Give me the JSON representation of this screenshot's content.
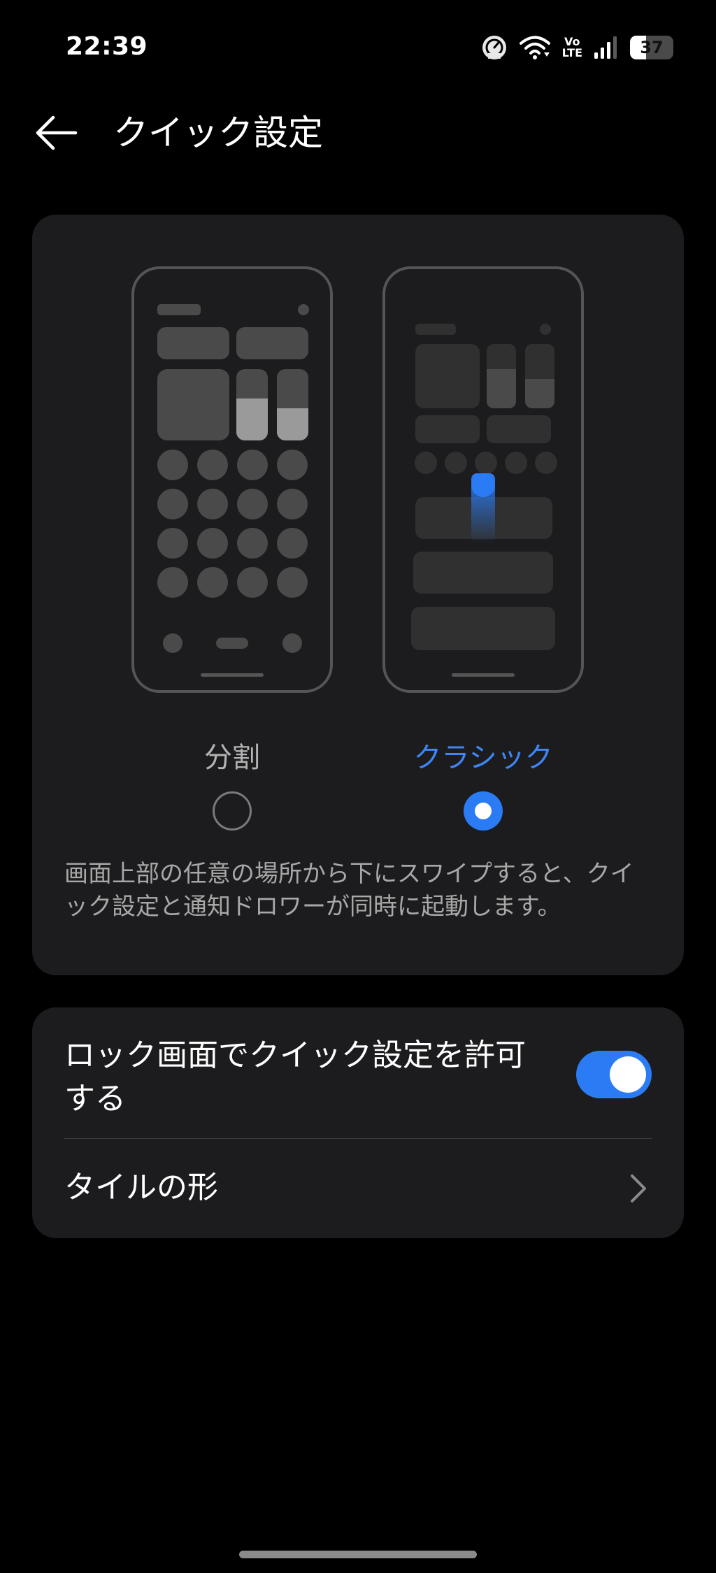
{
  "status_bar": {
    "time": "22:39",
    "volte_top": "Vo",
    "volte_bottom": "LTE",
    "battery_percent": "37",
    "icons": [
      "speedometer-icon",
      "wifi-icon",
      "volte-icon",
      "signal-icon",
      "battery-icon"
    ]
  },
  "header": {
    "back_icon": "arrow-left-icon",
    "title": "クイック設定"
  },
  "style_selector": {
    "options": [
      {
        "label": "分割",
        "selected": false
      },
      {
        "label": "クラシック",
        "selected": true
      }
    ],
    "description": "画面上部の任意の場所から下にスワイプすると、クイック設定と通知ドロワーが同時に起動します。"
  },
  "settings": {
    "lock_screen": {
      "label": "ロック画面でクイック設定を許可する",
      "enabled": true
    },
    "tile_shape": {
      "label": "タイルの形",
      "icon": "chevron-right-icon"
    }
  },
  "colors": {
    "accent": "#2b7cf4",
    "card_bg": "#1c1c1e",
    "background": "#000000",
    "secondary_text": "#a8a8a8"
  }
}
